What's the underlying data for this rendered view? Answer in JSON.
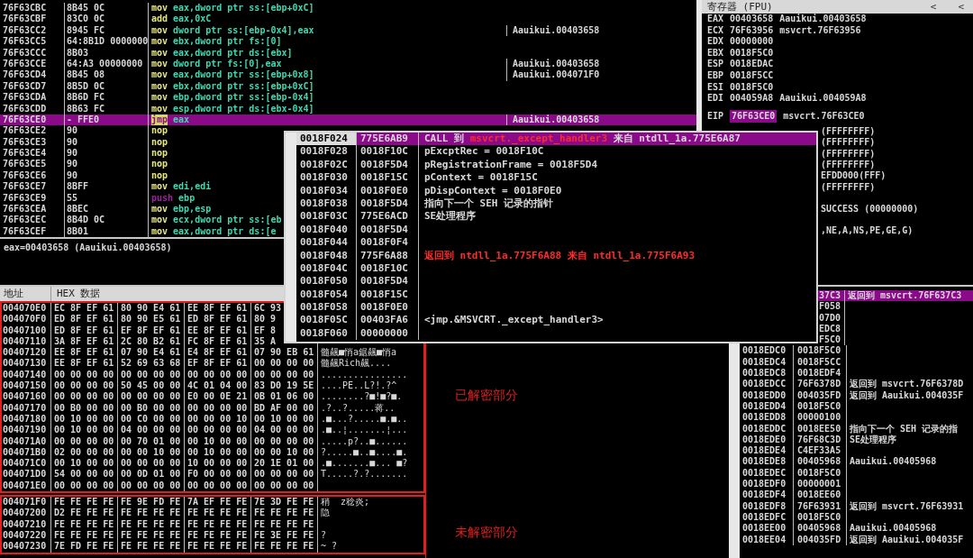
{
  "disassembly": {
    "rows": [
      {
        "address": "76F63CBC",
        "bytes": "8B45 0C",
        "mnemonic": "mov",
        "operands": "eax,dword ptr ss:[ebp+0xC]",
        "selected": false
      },
      {
        "address": "76F63CBF",
        "bytes": "83C0 0C",
        "mnemonic": "add",
        "operands": "eax,0xC",
        "selected": false
      },
      {
        "address": "76F63CC2",
        "bytes": "8945 FC",
        "mnemonic": "mov",
        "operands": "dword ptr ss:[ebp-0x4],eax",
        "comment": "Aauikui.00403658",
        "selected": false
      },
      {
        "address": "76F63CC5",
        "bytes": "64:8B1D 0000000",
        "mnemonic": "mov",
        "operands": "ebx,dword ptr fs:[0]",
        "selected": false
      },
      {
        "address": "76F63CCC",
        "bytes": "8B03",
        "mnemonic": "mov",
        "operands": "eax,dword ptr ds:[ebx]",
        "selected": false
      },
      {
        "address": "76F63CCE",
        "bytes": "64:A3 00000000",
        "mnemonic": "mov",
        "operands": "dword ptr fs:[0],eax",
        "comment": "Aauikui.00403658",
        "selected": false
      },
      {
        "address": "76F63CD4",
        "bytes": "8B45 08",
        "mnemonic": "mov",
        "operands": "eax,dword ptr ss:[ebp+0x8]",
        "comment": "Aauikui.004071F0",
        "selected": false
      },
      {
        "address": "76F63CD7",
        "bytes": "8B5D 0C",
        "mnemonic": "mov",
        "operands": "ebx,dword ptr ss:[ebp+0xC]",
        "selected": false
      },
      {
        "address": "76F63CDA",
        "bytes": "8B6D FC",
        "mnemonic": "mov",
        "operands": "ebp,dword ptr ss:[ebp-0x4]",
        "selected": false
      },
      {
        "address": "76F63CDD",
        "bytes": "8B63 FC",
        "mnemonic": "mov",
        "operands": "esp,dword ptr ds:[ebx-0x4]",
        "selected": false
      },
      {
        "address": "76F63CE0",
        "bytes": "- FFE0",
        "mnemonic": "jmp",
        "operands": "eax",
        "comment": "Aauikui.00403658",
        "selected": true
      },
      {
        "address": "76F63CE2",
        "bytes": "90",
        "mnemonic": "nop",
        "selected": false
      },
      {
        "address": "76F63CE3",
        "bytes": "90",
        "mnemonic": "nop",
        "selected": false
      },
      {
        "address": "76F63CE4",
        "bytes": "90",
        "mnemonic": "nop",
        "selected": false
      },
      {
        "address": "76F63CE5",
        "bytes": "90",
        "mnemonic": "nop",
        "selected": false
      },
      {
        "address": "76F63CE6",
        "bytes": "90",
        "mnemonic": "nop",
        "selected": false
      },
      {
        "address": "76F63CE7",
        "bytes": "8BFF",
        "mnemonic": "mov",
        "operands": "edi,edi",
        "selected": false
      },
      {
        "address": "76F63CE9",
        "bytes": "55",
        "mnemonic": "push",
        "operands": "ebp",
        "selected": false
      },
      {
        "address": "76F63CEA",
        "bytes": "8BEC",
        "mnemonic": "mov",
        "operands": "ebp,esp",
        "selected": false
      },
      {
        "address": "76F63CEC",
        "bytes": "8B4D 0C",
        "mnemonic": "mov",
        "operands": "ecx,dword ptr ss:[eb",
        "selected": false
      },
      {
        "address": "76F63CEF",
        "bytes": "8B01",
        "mnemonic": "mov",
        "operands": "eax,dword ptr ds:[e",
        "selected": false
      }
    ]
  },
  "status_line": "eax=00403658 (Aauikui.00403658)",
  "registers": {
    "title": "寄存器 (FPU)",
    "buttons": [
      "<",
      "<"
    ],
    "rows": [
      {
        "name": "EAX",
        "value": "00403658",
        "comment": "Aauikui.00403658"
      },
      {
        "name": "ECX",
        "value": "76F63956",
        "comment": "msvcrt.76F63956"
      },
      {
        "name": "EDX",
        "value": "00000000"
      },
      {
        "name": "EBX",
        "value": "0018F5C0"
      },
      {
        "name": "ESP",
        "value": "0018EDAC"
      },
      {
        "name": "EBP",
        "value": "0018F5CC"
      },
      {
        "name": "ESI",
        "value": "0018F5C0"
      },
      {
        "name": "EDI",
        "value": "004059A8",
        "comment": "Aauikui.004059A8"
      }
    ],
    "eip": {
      "name": "EIP",
      "value": "76F63CE0",
      "comment": "msvcrt.76F63CE0",
      "highlighted": true
    },
    "extra_lines": [
      [
        "(FFFFFFFF)",
        "(FFFFFFFF)",
        "(FFFFFFFF)",
        "(FFFFFFFF)",
        "EFDD000(FFF)",
        "(FFFFFFFF)"
      ],
      [
        "SUCCESS (00000000)"
      ],
      [
        ",NE,A,NS,PE,GE,G)"
      ]
    ]
  },
  "hex_dump": {
    "columns": [
      "地址",
      "HEX 数据"
    ],
    "sections": [
      {
        "rows": [
          {
            "address": "004070E0",
            "groups": [
              "EC 8F EF 61",
              "80 90 E4 61",
              "EE 8F EF 61",
              "6C 93"
            ]
          },
          {
            "address": "004070F0",
            "groups": [
              "ED 8F EF 61",
              "80 90 E5 61",
              "ED 8F EF 61",
              "80 9"
            ]
          },
          {
            "address": "00407100",
            "groups": [
              "ED 8F EF 61",
              "EF 8F EF 61",
              "EE 8F EF 61",
              "EF 8"
            ]
          },
          {
            "address": "00407110",
            "groups": [
              "3A 8F EF 61",
              "2C 80 B2 61",
              "FC 8F EF 61",
              "35 A"
            ]
          },
          {
            "address": "00407120",
            "groups": [
              "EE 8F EF 61",
              "07 90 E4 61",
              "E4 8F EF 61",
              "07 90 EB 61"
            ],
            "ascii": "髓飆■悄a鋸飆■悄a"
          },
          {
            "address": "00407130",
            "groups": [
              "EE 8F EF 61",
              "52 69 63 68",
              "EF 8F EF 61",
              "00 00 00 00"
            ],
            "ascii": "髓飆Rich飆...."
          },
          {
            "address": "00407140",
            "groups": [
              "00 00 00 00",
              "00 00 00 00",
              "00 00 00 00",
              "00 00 00 00"
            ],
            "ascii": "................"
          },
          {
            "address": "00407150",
            "groups": [
              "00 00 00 00",
              "50 45 00 00",
              "4C 01 04 00",
              "83 D0 19 5E"
            ],
            "ascii": "....PE..L?!.?^"
          },
          {
            "address": "00407160",
            "groups": [
              "00 00 00 00",
              "00 00 00 00",
              "E0 00 0E 21",
              "0B 01 06 00"
            ],
            "ascii": "........?■!■?■."
          },
          {
            "address": "00407170",
            "groups": [
              "00 B0 00 00",
              "00 B0 00 00",
              "00 00 00 00",
              "BD AF 00 00"
            ],
            "ascii": ".?..?.....蒋.."
          },
          {
            "address": "00407180",
            "groups": [
              "00 10 00 00",
              "00 C0 00 00",
              "00 00 00 10",
              "00 10 00 00"
            ],
            "ascii": ".■...?.....■.■.."
          },
          {
            "address": "00407190",
            "groups": [
              "00 10 00 00",
              "04 00 00 00",
              "00 00 00 00",
              "04 00 00 00"
            ],
            "ascii": ".■..¦.......¦..."
          },
          {
            "address": "004071A0",
            "groups": [
              "00 00 00 00",
              "00 70 01 00",
              "00 10 00 00",
              "00 00 00 00"
            ],
            "ascii": ".....p?..■......"
          },
          {
            "address": "004071B0",
            "groups": [
              "02 00 00 00",
              "00 00 10 00",
              "00 10 00 00",
              "00 00 10 00"
            ],
            "ascii": "?.....■..■....■."
          },
          {
            "address": "004071C0",
            "groups": [
              "00 10 00 00",
              "00 00 00 00",
              "10 00 00 00",
              "20 1E 01 00"
            ],
            "ascii": ".■.......■... ■?"
          },
          {
            "address": "004071D0",
            "groups": [
              "54 00 00 00",
              "00 0D 01 00",
              "F0 00 00 00",
              "00 00 00 00"
            ],
            "ascii": "T.....?.?......."
          },
          {
            "address": "004071E0",
            "groups": [
              "00 00 00 00",
              "00 00 00 00",
              "00 00 00 00",
              "00 00 00 00"
            ]
          }
        ]
      },
      {
        "rows": [
          {
            "address": "004071F0",
            "groups": [
              "FE FE FE FE",
              "FE 9E FD FE",
              "7A EF FE FE",
              "7E 3D FE FE"
            ],
            "ascii": "稍  z稔炎;"
          },
          {
            "address": "00407200",
            "groups": [
              "D2 FE FE FE",
              "FE FE FE FE",
              "FE FE FE FE",
              "FE FE FE FE"
            ],
            "ascii": "隐"
          },
          {
            "address": "00407210",
            "groups": [
              "FE FE FE FE",
              "FE FE FE FE",
              "FE FE FE FE",
              "FE FE FE FE"
            ]
          },
          {
            "address": "00407220",
            "groups": [
              "FE FE FE FE",
              "FE FE FE FE",
              "FE FE FE FE",
              "FE 3E FE FE"
            ],
            "ascii": "?"
          },
          {
            "address": "00407230",
            "groups": [
              "7E FD FE FE",
              "FE FE FE FE",
              "FE FE FE FE",
              "FE FE FE FE"
            ],
            "ascii": "~ ?"
          }
        ]
      }
    ]
  },
  "annotations": [
    "已解密部分",
    "未解密部分"
  ],
  "stack_window": {
    "rows": [
      {
        "address": "0018F024",
        "value": "775E6AB9",
        "selected": true,
        "comment": [
          {
            "text": "CALL 到 ",
            "kind": "plain"
          },
          {
            "text": "msvcrt._except_handler3",
            "kind": "symbol"
          },
          {
            "text": " 来自 ntdll_1a.775E6A87",
            "kind": "plain"
          }
        ]
      },
      {
        "address": "0018F028",
        "value": "0018F10C",
        "selected": false,
        "comment": [
          {
            "text": "pExcptRec = 0018F10C",
            "kind": "plain"
          }
        ]
      },
      {
        "address": "0018F02C",
        "value": "0018F5D4",
        "selected": false,
        "comment": [
          {
            "text": "pRegistrationFrame = 0018F5D4",
            "kind": "plain"
          }
        ]
      },
      {
        "address": "0018F030",
        "value": "0018F15C",
        "selected": false,
        "comment": [
          {
            "text": "pContext = 0018F15C",
            "kind": "plain"
          }
        ]
      },
      {
        "address": "0018F034",
        "value": "0018F0E0",
        "selected": false,
        "comment": [
          {
            "text": "pDispContext = 0018F0E0",
            "kind": "plain"
          }
        ]
      },
      {
        "address": "0018F038",
        "value": "0018F5D4",
        "selected": false,
        "comment": [
          {
            "text": "指向下一个 SEH 记录的指针",
            "kind": "plain"
          }
        ]
      },
      {
        "address": "0018F03C",
        "value": "775E6ACD",
        "selected": false,
        "comment": [
          {
            "text": "SE处理程序",
            "kind": "plain"
          }
        ]
      },
      {
        "address": "0018F040",
        "value": "0018F5D4",
        "selected": false
      },
      {
        "address": "0018F044",
        "value": "0018F0F4",
        "selected": false
      },
      {
        "address": "0018F048",
        "value": "775F6A88",
        "selected": false,
        "comment": [
          {
            "text": "返回到 ntdll_1a.775F6A88 来自 ntdll_1a.775F6A93",
            "kind": "symbol"
          }
        ]
      },
      {
        "address": "0018F04C",
        "value": "0018F10C",
        "selected": false
      },
      {
        "address": "0018F050",
        "value": "0018F5D4",
        "selected": false
      },
      {
        "address": "0018F054",
        "value": "0018F15C",
        "selected": false
      },
      {
        "address": "0018F058",
        "value": "0018F0E0",
        "selected": false
      },
      {
        "address": "0018F05C",
        "value": "00403FA6",
        "selected": false,
        "comment": [
          {
            "text": "<jmp.&MSVCRT._except_handler3>",
            "kind": "plain"
          }
        ]
      },
      {
        "address": "0018F060",
        "value": "00000000",
        "selected": false
      }
    ]
  },
  "stack_pane": {
    "partial_rows": [
      {
        "value": "37C3",
        "comment": "返回到 msvcrt.76F637C3",
        "selected": true
      },
      {
        "value": "F058",
        "selected": false
      },
      {
        "value": "07D0",
        "selected": false
      },
      {
        "value": "EDC8",
        "selected": false
      },
      {
        "value": "F5C0",
        "selected": false
      }
    ],
    "rows": [
      {
        "address": "0018EDC0",
        "value": "0018F5C0"
      },
      {
        "address": "0018EDC4",
        "value": "0018F5CC"
      },
      {
        "address": "0018EDC8",
        "value": "0018EDF4"
      },
      {
        "address": "0018EDCC",
        "value": "76F6378D",
        "comment": "返回到 msvcrt.76F6378D"
      },
      {
        "address": "0018EDD0",
        "value": "004035FD",
        "comment": "返回到 Aauikui.004035F"
      },
      {
        "address": "0018EDD4",
        "value": "0018F5C0"
      },
      {
        "address": "0018EDD8",
        "value": "00000100"
      },
      {
        "address": "0018EDDC",
        "value": "0018EE50",
        "comment": "指向下一个 SEH 记录的指"
      },
      {
        "address": "0018EDE0",
        "value": "76F68C3D",
        "comment": "SE处理程序"
      },
      {
        "address": "0018EDE4",
        "value": "C4EF33A5"
      },
      {
        "address": "0018EDE8",
        "value": "00405968",
        "comment": "Aauikui.00405968"
      },
      {
        "address": "0018EDEC",
        "value": "0018F5C0"
      },
      {
        "address": "0018EDF0",
        "value": "00000001"
      },
      {
        "address": "0018EDF4",
        "value": "0018EE60"
      },
      {
        "address": "0018EDF8",
        "value": "76F63931",
        "comment": "返回到 msvcrt.76F63931"
      },
      {
        "address": "0018EDFC",
        "value": "0018F5C0"
      },
      {
        "address": "0018EE00",
        "value": "00405968",
        "comment": "Aauikui.00405968"
      },
      {
        "address": "0018EE04",
        "value": "004035FD",
        "comment": "返回到 Aauikui.004035F"
      }
    ]
  }
}
